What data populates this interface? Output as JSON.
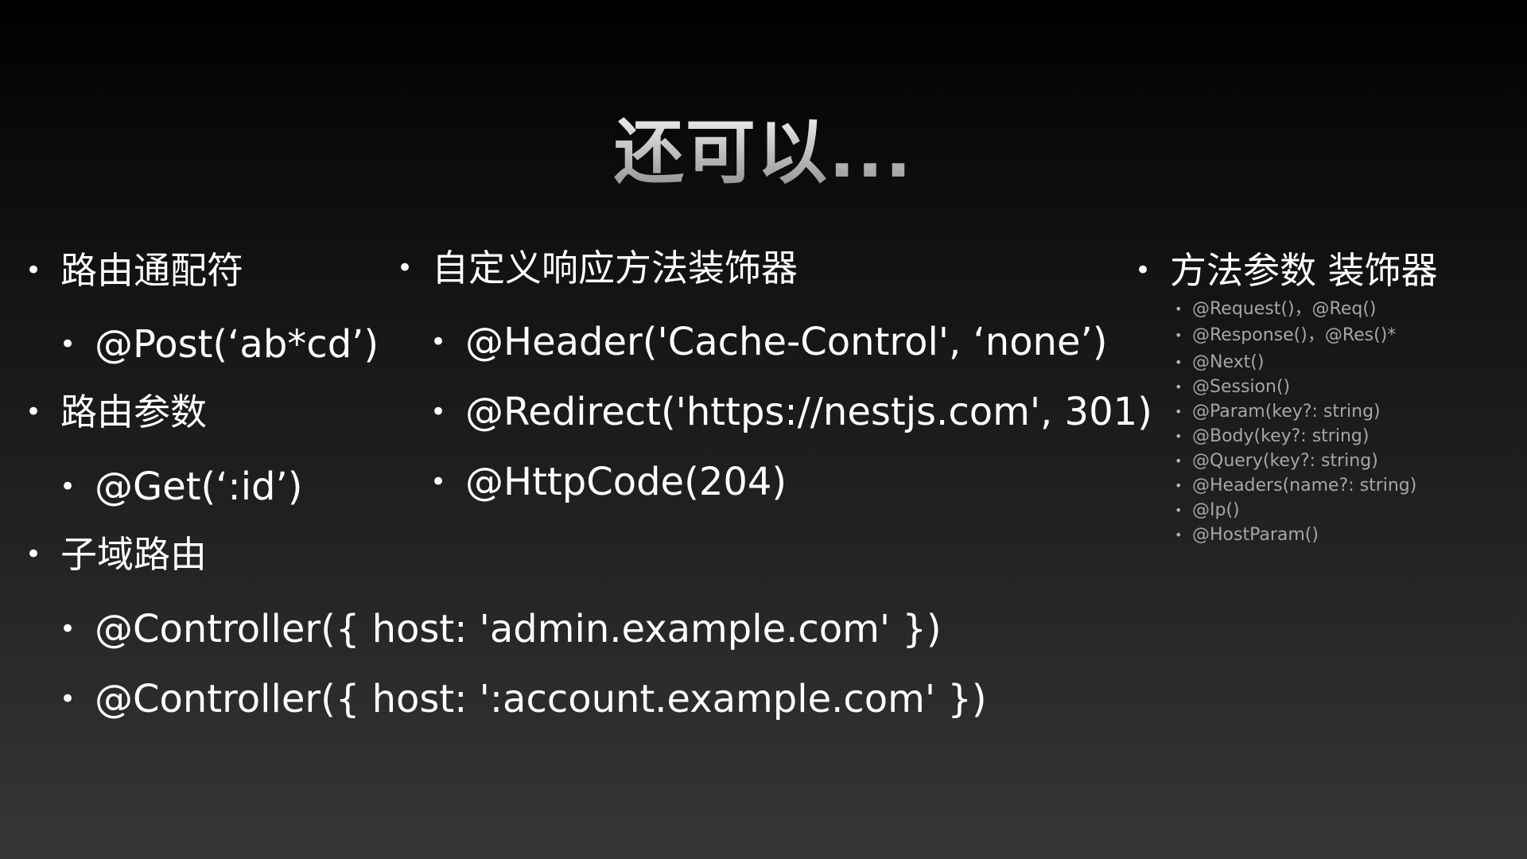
{
  "slide": {
    "title": "还可以..."
  },
  "columns": {
    "left": {
      "route_wildcard": {
        "heading": "路由通配符",
        "items": [
          "@Post(‘ab*cd’)"
        ]
      },
      "route_params": {
        "heading": "路由参数",
        "items": [
          "@Get(‘:id’)"
        ]
      },
      "subdomain_routing": {
        "heading": "子域路由",
        "items": [
          "@Controller({ host: 'admin.example.com' })",
          "@Controller({ host: ':account.example.com' })"
        ]
      }
    },
    "middle": {
      "heading": "自定义响应方法装饰器",
      "items": [
        "@Header('Cache-Control', ‘none’)",
        "@Redirect('https://nestjs.com', 301)",
        "@HttpCode(204)"
      ]
    },
    "right": {
      "heading": "方法参数 装饰器",
      "items": [
        "@Request()，@Req()",
        "@Response()，@Res()*",
        "@Next()",
        "@Session()",
        "@Param(key?: string)",
        "@Body(key?: string)",
        "@Query(key?: string)",
        "@Headers(name?: string)",
        "@Ip()",
        "@HostParam()"
      ]
    }
  }
}
